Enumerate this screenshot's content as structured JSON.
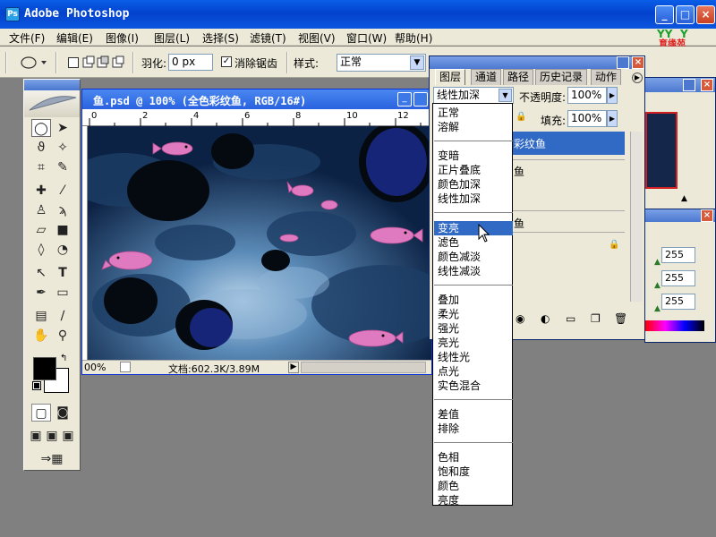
{
  "app": {
    "title": "Adobe Photoshop",
    "icon_letter": "Ps"
  },
  "window_controls": {
    "minimize": "_",
    "maximize": "□",
    "close": "×"
  },
  "menu": [
    "文件(F)",
    "编辑(E)",
    "图像(I)",
    "图层(L)",
    "选择(S)",
    "滤镜(T)",
    "视图(V)",
    "窗口(W)",
    "帮助(H)"
  ],
  "logo": {
    "text": "育缘苑",
    "color": "#e02020",
    "accent": "#1aa02a"
  },
  "options": {
    "feather_label": "羽化:",
    "feather_value": "0 px",
    "antialias_label": "消除锯齿",
    "antialias_checked": true,
    "style_label": "样式:",
    "style_value": "正常"
  },
  "document": {
    "title": "鱼.psd @ 100% (全色彩纹鱼, RGB/16#)",
    "ruler_marks": [
      "0",
      "2",
      "4",
      "6",
      "8",
      "10",
      "12"
    ],
    "zoom": "00%",
    "doc_info": "文档:602.3K/3.89M"
  },
  "layers": {
    "tabs": [
      "图层",
      "通道",
      "路径",
      "历史记录",
      "动作"
    ],
    "blend_mode": "线性加深",
    "opacity_label": "不透明度:",
    "opacity_value": "100%",
    "fill_label": "填充:",
    "fill_value": "100%",
    "layer_name_fragment": "彩纹鱼",
    "frag_1": "鱼",
    "frag_2": "鱼"
  },
  "color_panel": {
    "values": [
      "255",
      "255",
      "255"
    ]
  },
  "blend_menu": {
    "groups": [
      [
        "正常",
        "溶解"
      ],
      [
        "变暗",
        "正片叠底",
        "颜色加深",
        "线性加深"
      ],
      [
        "变亮",
        "滤色",
        "颜色减淡",
        "线性减淡"
      ],
      [
        "叠加",
        "柔光",
        "强光",
        "亮光",
        "线性光",
        "点光",
        "实色混合"
      ],
      [
        "差值",
        "排除"
      ],
      [
        "色相",
        "饱和度",
        "颜色",
        "亮度"
      ]
    ],
    "highlighted": "变亮"
  },
  "colors": {
    "xp_blue": "#0342cc",
    "xp_face": "#ece9d8",
    "selection": "#316ac5",
    "workspace": "#808080",
    "fish_pink": "#e07ac0",
    "water_dark": "#0c2244",
    "water_light": "#6f9fc8"
  },
  "icons": [
    "photoshop-icon",
    "marquee-icon",
    "move-icon",
    "lasso-icon",
    "magic-wand-icon",
    "crop-icon",
    "slice-icon",
    "healing-icon",
    "brush-icon",
    "stamp-icon",
    "history-brush-icon",
    "eraser-icon",
    "gradient-icon",
    "blur-icon",
    "dodge-icon",
    "path-select-icon",
    "type-icon",
    "pen-icon",
    "shape-icon",
    "notes-icon",
    "eyedropper-icon",
    "hand-icon",
    "zoom-icon",
    "quickmask-icon",
    "screen-mode-icon",
    "imageready-icon"
  ]
}
